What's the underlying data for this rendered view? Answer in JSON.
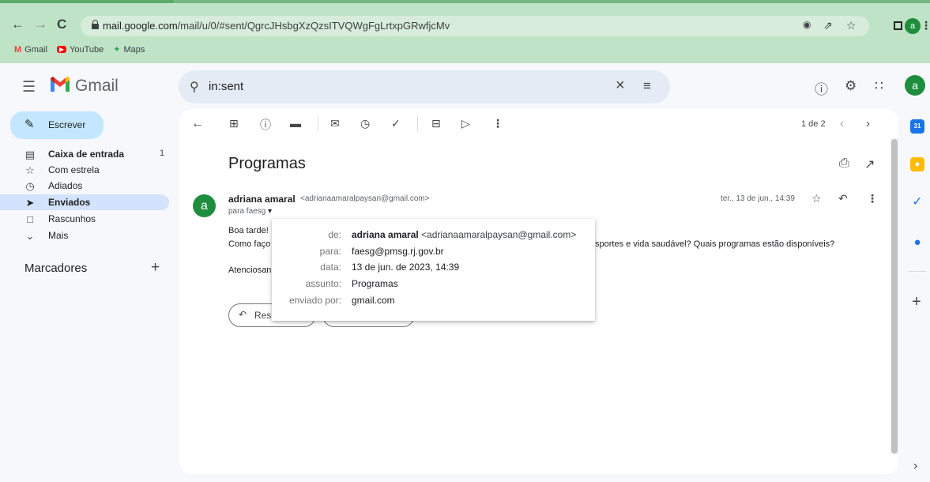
{
  "browser": {
    "url_host": "mail.google.com",
    "url_path": "/mail/u/0/#sent/QgrcJHsbgXzQzsITVQWgFgLrtxpGRwfjcMv",
    "profile_initial": "a",
    "bookmarks": [
      {
        "label": "Gmail"
      },
      {
        "label": "YouTube"
      },
      {
        "label": "Maps"
      }
    ]
  },
  "gmail": {
    "title": "Gmail",
    "search_query": "in:sent",
    "account_initial": "a"
  },
  "sidebar": {
    "compose_label": "Escrever",
    "items": [
      {
        "label": "Caixa de entrada",
        "count": "1",
        "icon": "inbox-icon"
      },
      {
        "label": "Com estrela",
        "count": "",
        "icon": "star-icon"
      },
      {
        "label": "Adiados",
        "count": "",
        "icon": "clock-icon"
      },
      {
        "label": "Enviados",
        "count": "",
        "icon": "send-icon"
      },
      {
        "label": "Rascunhos",
        "count": "",
        "icon": "draft-icon"
      },
      {
        "label": "Mais",
        "count": "",
        "icon": "chevron-down-icon"
      }
    ],
    "labels_title": "Marcadores"
  },
  "toolbar": {
    "pagination": "1 de 2"
  },
  "message": {
    "subject": "Programas",
    "sender_initial": "a",
    "sender_name": "adriana amaral",
    "sender_email": "<adrianaamaralpaysan@gmail.com>",
    "to_line": "para faesg",
    "date": "ter., 13 de jun., 14:39",
    "body": {
      "greeting": "Boa tarde!",
      "line2_start": "Como faço",
      "line2_end": "sportes e vida saudável? Quais programas estão disponíveis?",
      "signoff": "Atenciosan"
    },
    "reply_label": "Res"
  },
  "details_popup": {
    "rows": [
      {
        "key": "de:",
        "value_name": "adriana amaral",
        "value_email": "<adrianaamaralpaysan@gmail.com>"
      },
      {
        "key": "para:",
        "value": "faesg@pmsg.rj.gov.br"
      },
      {
        "key": "data:",
        "value": "13 de jun. de 2023, 14:39"
      },
      {
        "key": "assunto:",
        "value": "Programas"
      },
      {
        "key": "enviado por:",
        "value": "gmail.com"
      }
    ]
  },
  "colors": {
    "chrome_bg": "#bfe3c6",
    "compose_bg": "#c2e7ff",
    "active_nav_bg": "#d3e3fd",
    "avatar_green": "#1e8e3e"
  }
}
